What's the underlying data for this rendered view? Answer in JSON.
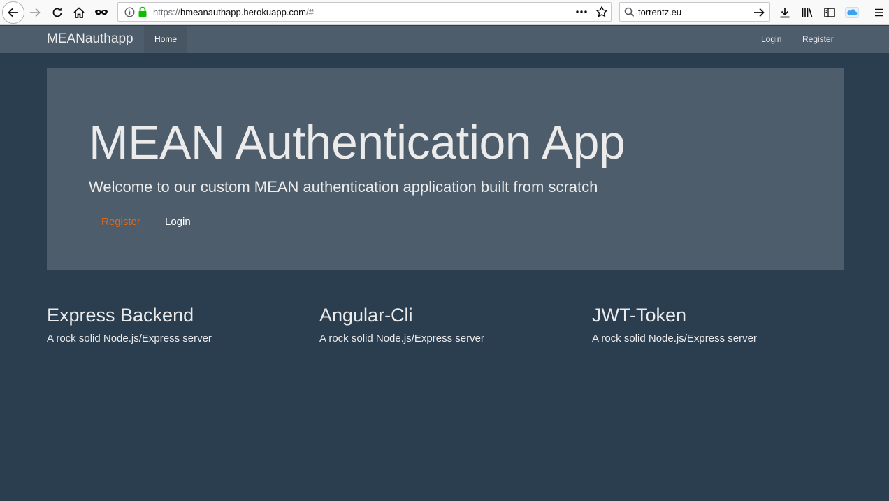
{
  "browser": {
    "url_scheme": "https://",
    "url_host": "hmeanauthapp.herokuapp.com",
    "url_path": "/#",
    "search_value": "torrentz.eu",
    "icons": [
      "back-arrow-icon",
      "forward-arrow-icon",
      "reload-icon",
      "home-icon",
      "mask-icon",
      "info-icon",
      "lock-icon",
      "more-icon",
      "bookmark-star-icon",
      "search-icon",
      "go-arrow-icon",
      "download-icon",
      "library-icon",
      "sidebar-icon",
      "cloud-icon",
      "menu-icon"
    ],
    "lock_color": "#12bc00"
  },
  "navbar": {
    "brand": "MEANauthapp",
    "home": "Home",
    "login": "Login",
    "register": "Register"
  },
  "jumbotron": {
    "title": "MEAN Authentication App",
    "lead": "Welcome to our custom MEAN authentication application built from scratch",
    "register": "Register",
    "login": "Login"
  },
  "features": [
    {
      "title": "Express Backend",
      "text": "A rock solid Node.js/Express server"
    },
    {
      "title": "Angular-Cli",
      "text": "A rock solid Node.js/Express server"
    },
    {
      "title": "JWT-Token",
      "text": "A rock solid Node.js/Express server"
    }
  ],
  "colors": {
    "background": "#2b3e50",
    "panel": "#4e5d6c",
    "accent": "#df691a",
    "text": "#ebebeb"
  }
}
